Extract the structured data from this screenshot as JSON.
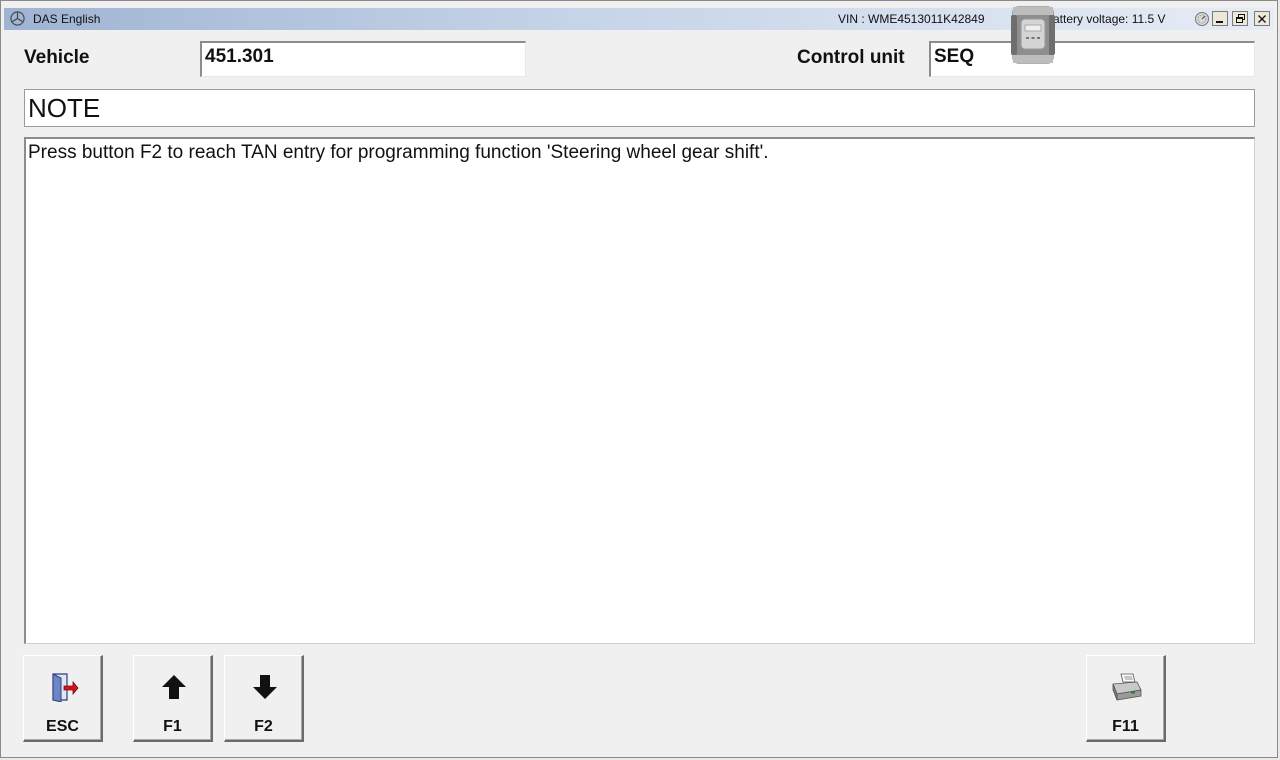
{
  "window": {
    "title": "DAS English",
    "vin": "VIN : WME4513011K42849",
    "battery": "attery voltage: 11.5 V"
  },
  "header": {
    "vehicle_label": "Vehicle",
    "vehicle_value": "451.301",
    "control_unit_label": "Control unit",
    "control_unit_value": "SEQ"
  },
  "note": {
    "label": "NOTE",
    "message": "Press button F2 to reach TAN entry for programming function 'Steering wheel gear shift'."
  },
  "function_keys": [
    {
      "label": "ESC",
      "icon": "exit-door-icon"
    },
    {
      "label": "F1",
      "icon": "arrow-up-icon"
    },
    {
      "label": "F2",
      "icon": "arrow-down-icon"
    },
    {
      "label": "F11",
      "icon": "printer-icon"
    }
  ],
  "icons": {
    "title": "mercedes-star-icon",
    "gauge": "gauge-icon",
    "device": "diagnostic-device-icon",
    "minimize": "minimize-icon",
    "restore": "restore-icon",
    "close": "close-icon"
  }
}
